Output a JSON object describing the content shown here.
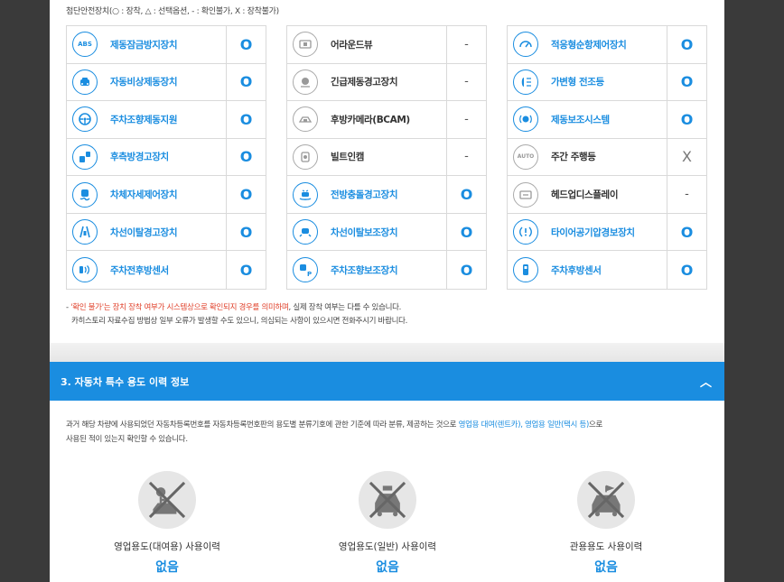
{
  "legend": "첨단안전장치(○ : 장착, △ : 선택옵션, - : 확인불가, X : 장착불가)",
  "groups": [
    {
      "items": [
        {
          "name": "제동잠금방지장치",
          "icon": "abs-icon",
          "icon_text": "ABS",
          "status": "O"
        },
        {
          "name": "자동비상제동장치",
          "icon": "car-front-icon",
          "status": "O"
        },
        {
          "name": "주차조향제동지원",
          "icon": "steering-icon",
          "status": "O"
        },
        {
          "name": "후측방경고장치",
          "icon": "rear-side-warning-icon",
          "status": "O"
        },
        {
          "name": "차체자세제어장치",
          "icon": "stability-control-icon",
          "status": "O"
        },
        {
          "name": "차선이탈경고장치",
          "icon": "lane-warning-icon",
          "status": "O"
        },
        {
          "name": "주차전후방센서",
          "icon": "parking-sensor-icon",
          "status": "O"
        }
      ]
    },
    {
      "items": [
        {
          "name": "어라운드뷰",
          "icon": "around-view-icon",
          "status": "-"
        },
        {
          "name": "긴급제동경고장치",
          "icon": "emergency-brake-icon",
          "status": "-"
        },
        {
          "name": "후방카메라(BCAM)",
          "icon": "rear-camera-icon",
          "status": "-"
        },
        {
          "name": "빌트인캠",
          "icon": "builtin-cam-icon",
          "status": "-"
        },
        {
          "name": "전방충돌경고장치",
          "icon": "forward-collision-icon",
          "status": "O"
        },
        {
          "name": "차선이탈보조장치",
          "icon": "lane-assist-icon",
          "status": "O"
        },
        {
          "name": "주차조향보조장치",
          "icon": "parking-assist-icon",
          "status": "O"
        }
      ]
    },
    {
      "items": [
        {
          "name": "적응형순항제어장치",
          "icon": "adaptive-cruise-icon",
          "status": "O"
        },
        {
          "name": "가변형 전조등",
          "icon": "headlamp-icon",
          "status": "O"
        },
        {
          "name": "제동보조시스템",
          "icon": "brake-assist-icon",
          "status": "O"
        },
        {
          "name": "주간 주행등",
          "icon": "daytime-light-icon",
          "icon_text": "AUTO",
          "status": "X"
        },
        {
          "name": "헤드업디스플레이",
          "icon": "hud-icon",
          "status": "-"
        },
        {
          "name": "타이어공기압경보장치",
          "icon": "tire-pressure-icon",
          "status": "O"
        },
        {
          "name": "주차후방센서",
          "icon": "rear-sensor-icon",
          "status": "O"
        }
      ]
    }
  ],
  "notes": {
    "line1_prefix": "- ",
    "line1_red": "'확인 불가'는 장치 장착 여부가 시스템상으로 확인되지 경우를 의미하며",
    "line1_rest": ", 실제 장착 여부는 다를 수 있습니다.",
    "line2": "카히스토리 자료수집 방법상 일부 오류가 발생할 수도 있으니, 의심되는 사항이 있으시면 전화주시기 바랍니다."
  },
  "section": {
    "title": "3. 자동차 특수 용도 이력 정보",
    "chevron": "︿"
  },
  "description": {
    "part1": "과거 해당 차량에 사용되었던 자동차등록번호를 자동차등록번호판의 용도별 분류기호에 관한 기준에 따라 분류, 제공하는 것으로 ",
    "highlight": "영업용 대여(렌트카), 영업용 일반(택시 등)",
    "part2": "으로",
    "line2": "사용된 적이 있는지 확인할 수 있습니다."
  },
  "usage": [
    {
      "label": "영업용도(대여용) 사용이력",
      "value": "없음",
      "icon": "rental-car-icon"
    },
    {
      "label": "영업용도(일반) 사용이력",
      "value": "없음",
      "icon": "taxi-icon"
    },
    {
      "label": "관용용도 사용이력",
      "value": "없음",
      "icon": "government-car-icon"
    }
  ]
}
